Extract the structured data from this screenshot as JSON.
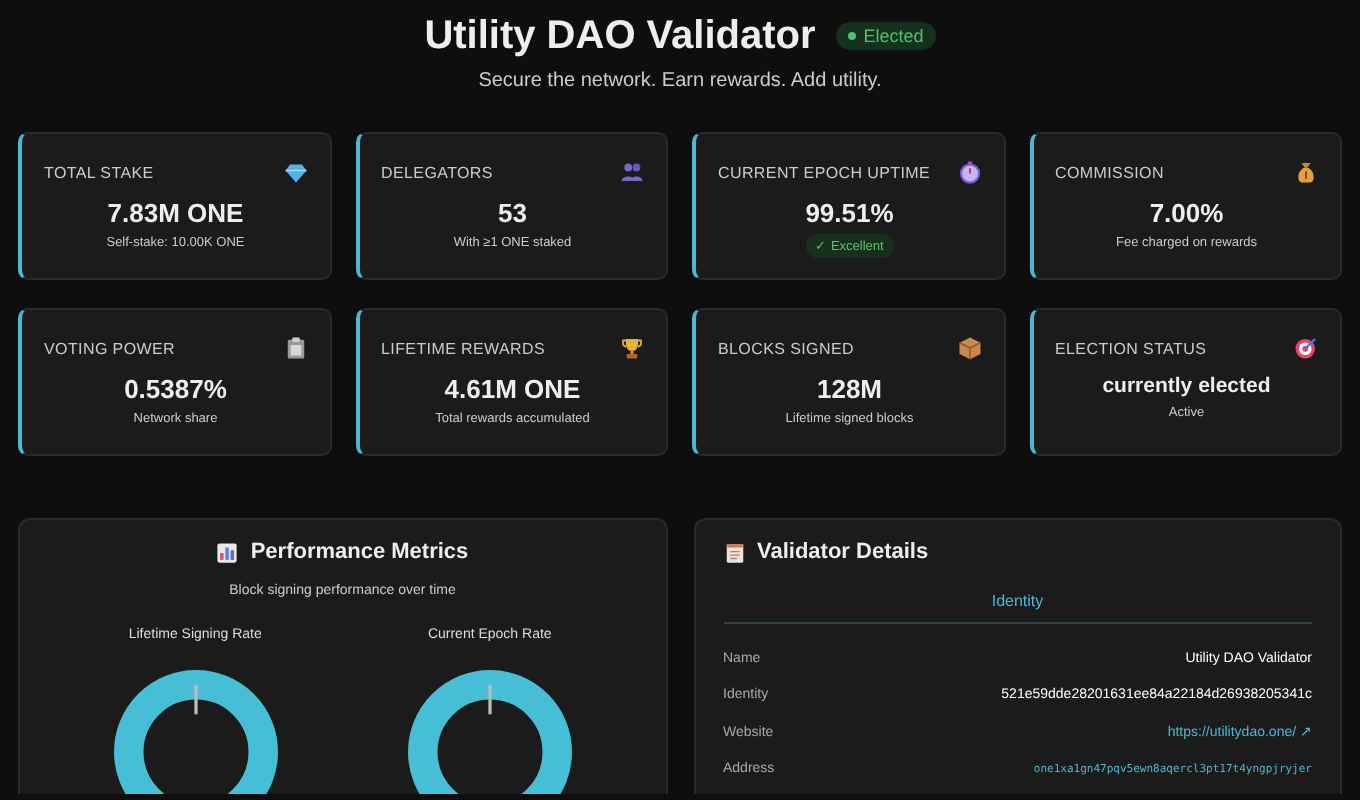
{
  "header": {
    "title": "Utility DAO Validator",
    "badge": {
      "label": "Elected",
      "elected": true
    },
    "subtitle": "Secure the network. Earn rewards. Add utility."
  },
  "stats": [
    {
      "label": "TOTAL STAKE",
      "value": "7.83M ONE",
      "note": "Self-stake: 10.00K ONE"
    },
    {
      "label": "DELEGATORS",
      "value": "53",
      "note": "With ≥1 ONE staked"
    },
    {
      "label": "CURRENT EPOCH UPTIME",
      "value": "99.51%",
      "tag": "✓ Excellent"
    },
    {
      "label": "COMMISSION",
      "value": "7.00%",
      "note": "Fee charged on rewards"
    },
    {
      "label": "VOTING POWER",
      "value": "0.5387%",
      "note": "Network share"
    },
    {
      "label": "LIFETIME REWARDS",
      "value": "4.61M ONE",
      "note": "Total rewards accumulated"
    },
    {
      "label": "BLOCKS SIGNED",
      "value": "128M",
      "note": "Lifetime signed blocks"
    },
    {
      "label": "ELECTION STATUS",
      "value": "currently elected",
      "note": "Active"
    }
  ],
  "performance": {
    "title": "Performance Metrics",
    "subtitle": "Block signing performance over time",
    "donuts": [
      {
        "label": "Lifetime Signing Rate"
      },
      {
        "label": "Current Epoch Rate"
      }
    ]
  },
  "details": {
    "title": "Validator Details",
    "tabs": [
      {
        "label": "Identity",
        "selected": true
      }
    ],
    "rows": [
      {
        "key": "Name",
        "value": "Utility DAO Validator",
        "kind": "text"
      },
      {
        "key": "Identity",
        "value": "521e59dde28201631ee84a22184d26938205341c",
        "kind": "text"
      },
      {
        "key": "Website",
        "value": "https://utilitydao.one/ ↗",
        "kind": "link"
      },
      {
        "key": "Address",
        "value": "one1xa1gn47pqv5ewn8aqercl3pt17t4yngpjryjer",
        "kind": "mono"
      }
    ]
  }
}
